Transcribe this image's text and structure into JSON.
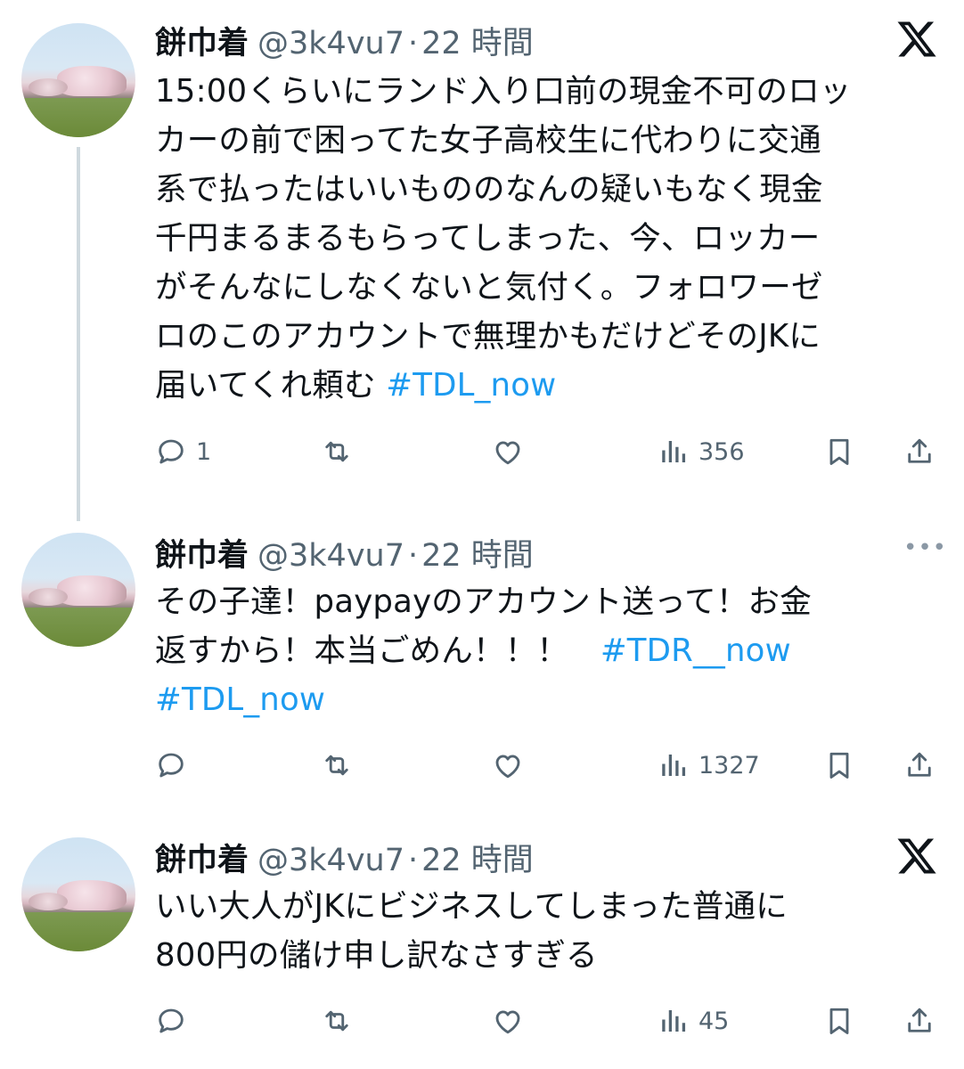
{
  "tweets": [
    {
      "name": "餅巾着",
      "handle": "@3k4vu7",
      "dot": "·",
      "time": "22 時間",
      "lines": [
        "15:00くらいにランド入り口前の現金不可のロッ",
        "カーの前で困ってた女子高校生に代わりに交通",
        "系で払ったはいいもののなんの疑いもなく現金",
        "千円まるまるもらってしまった、今、ロッカー",
        "がそんなにしなくないと気付く。フォロワーゼ",
        "ロのこのアカウントで無理かもだけどそのJKに",
        "届いてくれ頼む "
      ],
      "hashtags_line7": "#TDL_now",
      "reply_count": "1",
      "views": "356",
      "corner_icon": "x-logo-icon"
    },
    {
      "name": "餅巾着",
      "handle": "@3k4vu7",
      "dot": "·",
      "time": "22 時間",
      "lines": [
        "その子達！paypayのアカウント送って！お金",
        "返すから！本当ごめん！！！　"
      ],
      "hashtag_line2": "#TDR__now",
      "hashtag_line3": "#TDL_now",
      "views": "1327",
      "corner_icon": "more-icon",
      "more_text": "•••"
    },
    {
      "name": "餅巾着",
      "handle": "@3k4vu7",
      "dot": "·",
      "time": "22 時間",
      "lines": [
        "いい大人がJKにビジネスしてしまった普通に",
        "800円の儲け申し訳なさすぎる"
      ],
      "views": "45",
      "corner_icon": "x-logo-icon"
    }
  ],
  "colors": {
    "text": "#0f1419",
    "secondary": "#536471",
    "hashtag": "#1d9bf0",
    "thread_line": "#cfd9de"
  }
}
